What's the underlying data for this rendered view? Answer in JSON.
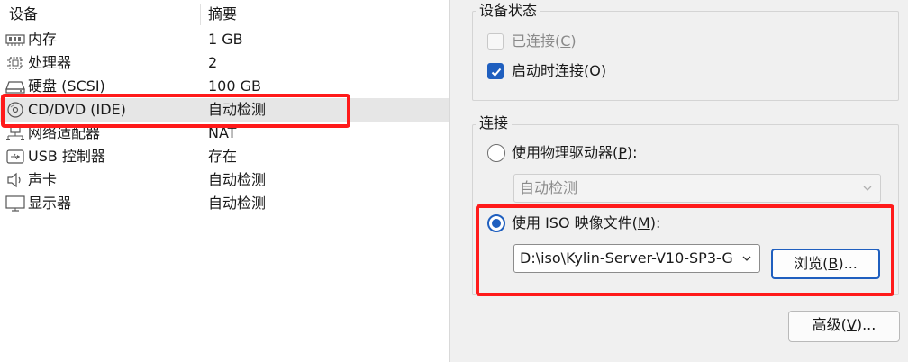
{
  "device_list": {
    "headers": {
      "device": "设备",
      "summary": "摘要"
    },
    "rows": [
      {
        "name": "内存",
        "summary": "1 GB",
        "icon": "memory-icon"
      },
      {
        "name": "处理器",
        "summary": "2",
        "icon": "cpu-icon"
      },
      {
        "name": "硬盘 (SCSI)",
        "summary": "100 GB",
        "icon": "harddisk-icon"
      },
      {
        "name": "CD/DVD (IDE)",
        "summary": "自动检测",
        "icon": "cdrom-icon"
      },
      {
        "name": "网络适配器",
        "summary": "NAT",
        "icon": "network-icon"
      },
      {
        "name": "USB 控制器",
        "summary": "存在",
        "icon": "usb-icon"
      },
      {
        "name": "声卡",
        "summary": "自动检测",
        "icon": "speaker-icon"
      },
      {
        "name": "显示器",
        "summary": "自动检测",
        "icon": "monitor-icon"
      }
    ],
    "selected_index": 3
  },
  "device_status": {
    "title": "设备状态",
    "connected": {
      "text": "已连接(",
      "key": "C",
      "end": ")",
      "checked": false,
      "enabled": false
    },
    "connect_on_power": {
      "text": "启动时连接(",
      "key": "O",
      "end": ")",
      "checked": true
    }
  },
  "connection": {
    "title": "连接",
    "physical": {
      "text": "使用物理驱动器(",
      "key": "P",
      "end": "):",
      "selected": false
    },
    "physical_drive_value": "自动检测",
    "iso": {
      "text": "使用 ISO 映像文件(",
      "key": "M",
      "end": "):",
      "selected": true
    },
    "iso_path": "D:\\iso\\Kylin-Server-V10-SP3-G",
    "browse": {
      "text": "浏览(",
      "key": "B",
      "end": ")..."
    }
  },
  "advanced": {
    "text": "高级(",
    "key": "V",
    "end": ")..."
  },
  "colors": {
    "accent": "#1f5fbf",
    "highlight": "#ff1a1a"
  }
}
